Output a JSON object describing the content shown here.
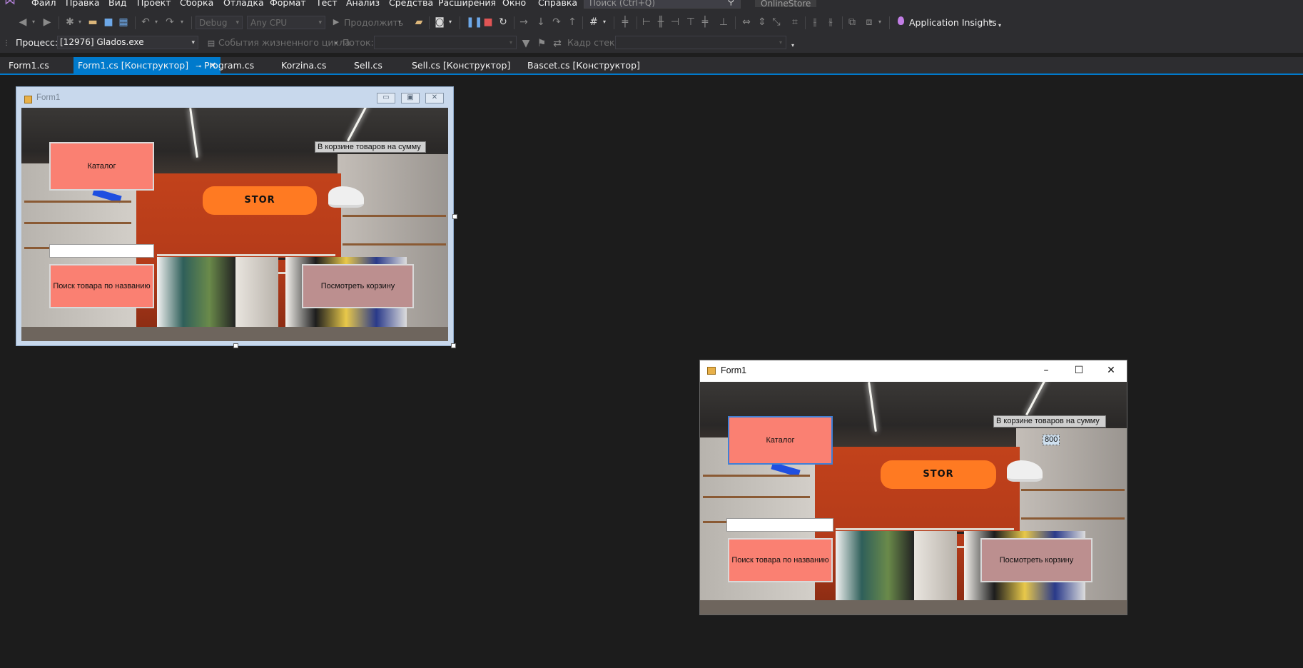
{
  "menu": {
    "items": [
      "Файл",
      "Правка",
      "Вид",
      "Проект",
      "Сборка",
      "Отладка",
      "Формат",
      "Тест",
      "Анализ",
      "Средства",
      "Расширения",
      "Окно",
      "Справка"
    ],
    "search_placeholder": "Поиск (Ctrl+Q)",
    "solution_name": "OnlineStore"
  },
  "toolbar": {
    "configuration": "Debug",
    "platform": "Any CPU",
    "continue_label": "Продолжить",
    "app_insights_label": "Application Insights"
  },
  "debug_toolbar": {
    "process_label": "Процесс:",
    "process_value": "[12976] Glados.exe",
    "lifecycle_events_label": "События жизненного цикла",
    "thread_label": "Поток:",
    "stack_frame_label": "Кадр стека:"
  },
  "tabs": [
    {
      "label": "Form1.cs",
      "active": false
    },
    {
      "label": "Form1.cs [Конструктор]",
      "active": true
    },
    {
      "label": "Program.cs",
      "active": false
    },
    {
      "label": "Korzina.cs",
      "active": false
    },
    {
      "label": "Sell.cs",
      "active": false
    },
    {
      "label": "Sell.cs [Конструктор]",
      "active": false
    },
    {
      "label": "Bascet.cs [Конструктор]",
      "active": false
    }
  ],
  "designer_form": {
    "title": "Form1",
    "catalog_button": "Каталог",
    "cart_sum_label": "В корзине товаров на сумму",
    "search_button": "Поиск товара по названию",
    "view_cart_button": "Посмотреть корзину",
    "logo_text": "STOR"
  },
  "running_form": {
    "title": "Form1",
    "catalog_button": "Каталог",
    "cart_sum_label": "В корзине товаров на сумму",
    "cart_sum_value": "800",
    "search_button": "Поиск товара по названию",
    "view_cart_button": "Посмотреть корзину",
    "logo_text": "STOR",
    "caption_buttons": [
      "–",
      "☐",
      "✕"
    ]
  },
  "colors": {
    "accent": "#007acc",
    "button_salmon": "#fa8072",
    "button_rosy": "#bc8f8f",
    "app_insights_icon": "#c27ee6"
  }
}
